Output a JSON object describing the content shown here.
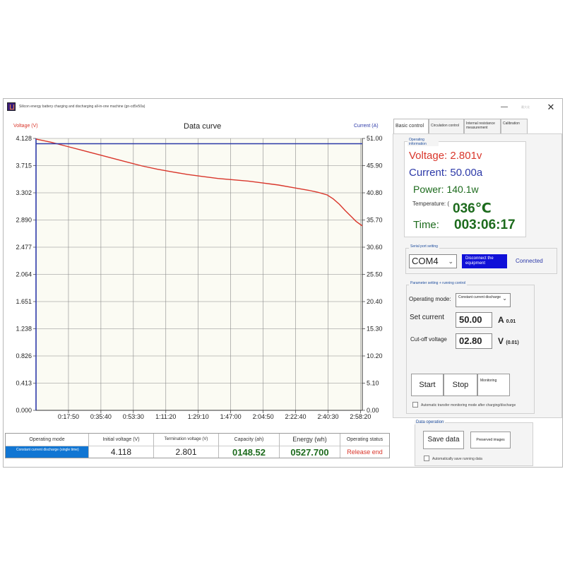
{
  "window": {
    "title": "Silicon energy battery charging and discharging all-in-one machine (gn-cd5v50a)",
    "min_glyph": "—",
    "max_glyph": "最大化",
    "close_glyph": "✕"
  },
  "chart": {
    "title": "Data curve",
    "left_axis_title": "Voltage (V)",
    "right_axis_title": "Current (A)"
  },
  "chart_data": {
    "type": "line",
    "title": "Data curve",
    "xlabel": "",
    "ylabel": "Voltage (V)",
    "y2label": "Current (A)",
    "xlim": [
      0,
      10760
    ],
    "ylim": [
      0,
      4.128
    ],
    "y2lim": [
      0,
      51.0
    ],
    "x_tick_labels": [
      "0:17:50",
      "0:35:40",
      "0:53:30",
      "1:11:20",
      "1:29:10",
      "1:47:00",
      "2:04:50",
      "2:22:40",
      "2:40:30",
      "2:58:20"
    ],
    "x_tick_values": [
      1070,
      2140,
      3210,
      4280,
      5350,
      6420,
      7490,
      8560,
      9630,
      10700
    ],
    "y_tick_labels": [
      "0.000",
      "0.413",
      "0.826",
      "1.238",
      "1.651",
      "2.064",
      "2.477",
      "2.890",
      "3.302",
      "3.715",
      "4.128"
    ],
    "y2_tick_labels": [
      "0.00",
      "5.10",
      "10.20",
      "15.30",
      "20.40",
      "25.50",
      "30.60",
      "35.70",
      "40.80",
      "45.90",
      "51.00"
    ],
    "grid": true,
    "series": [
      {
        "name": "Voltage",
        "axis": "left",
        "color": "#d9362b",
        "x": [
          0,
          500,
          1000,
          1500,
          2000,
          2500,
          3000,
          3500,
          4000,
          4500,
          5000,
          5500,
          6000,
          6500,
          7000,
          7500,
          8000,
          8500,
          9000,
          9300,
          9600,
          9800,
          10000,
          10200,
          10400,
          10550,
          10700,
          10760
        ],
        "y": [
          4.118,
          4.07,
          4.01,
          3.95,
          3.89,
          3.83,
          3.77,
          3.71,
          3.66,
          3.62,
          3.58,
          3.55,
          3.52,
          3.5,
          3.48,
          3.45,
          3.42,
          3.38,
          3.34,
          3.31,
          3.27,
          3.21,
          3.13,
          3.03,
          2.94,
          2.87,
          2.82,
          2.801
        ]
      },
      {
        "name": "Current",
        "axis": "right",
        "color": "#2c39a8",
        "x": [
          0,
          10760
        ],
        "y": [
          50.0,
          50.0
        ]
      }
    ]
  },
  "status_table": {
    "headers": [
      "Operating mode",
      "Initial voltage (V)",
      "Termination voltage (V)",
      "Capacity (ah)",
      "Energy (wh)",
      "Operating status"
    ],
    "values": [
      "Constant current discharge (single time)",
      "4.118",
      "2.801",
      "0148.52",
      "0527.700",
      "Release end"
    ]
  },
  "tabs": [
    "Basic control",
    "Circulation control",
    "Internal resistance measurement",
    "Calibration"
  ],
  "operating_info": {
    "label": "Operating information",
    "voltage": "Voltage: 2.801v",
    "current": "Current: 50.00a",
    "power": "Power: 140.1w",
    "temperature_label": "Temperature: (",
    "temperature_value": "036℃",
    "time_label": "Time:",
    "time_value": "003:06:17"
  },
  "serial_port": {
    "label": "Serial port setting",
    "port": "COM4",
    "disconnect_label": "Disconnect the equipment",
    "status": "Connected"
  },
  "parameters": {
    "label": "Parameter setting + running control",
    "mode_label": "Operating mode:",
    "mode_value": "Constant current discharge",
    "set_current_label": "Set current",
    "set_current_value": "50.00",
    "current_unit": "A",
    "current_step": "0.01",
    "cutoff_label": "Cut-off voltage",
    "cutoff_value": "02.80",
    "voltage_unit": "V",
    "voltage_step": "(0.01)",
    "start_label": "Start",
    "stop_label": "Stop",
    "monitoring_label": "Monitoring",
    "auto_transfer_label": "Automatic transfer monitoring mode after charging/discharge"
  },
  "data_operation": {
    "label": "Data operation",
    "save_label": "Save data",
    "preserved_label": "Preserved images",
    "auto_save_label": "Automatically save running data"
  }
}
